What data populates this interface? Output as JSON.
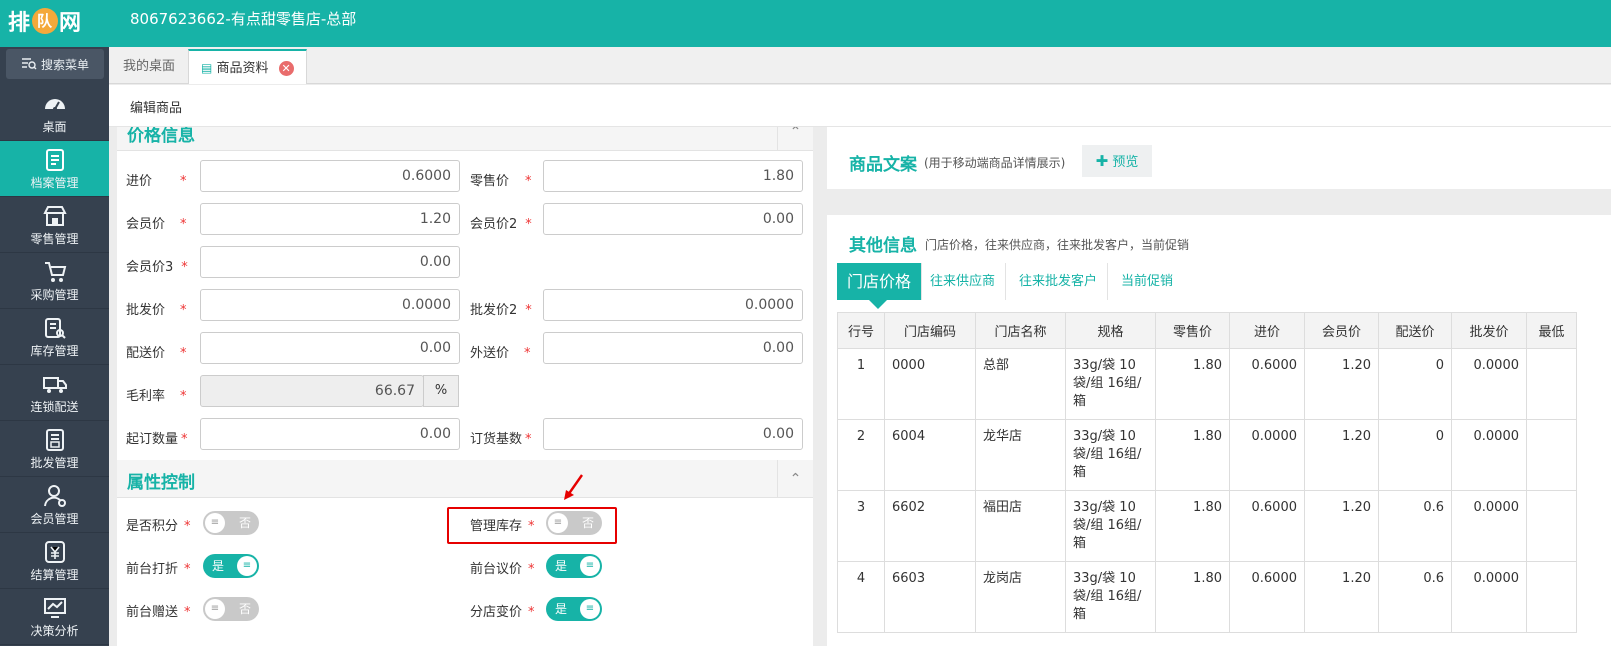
{
  "app": {
    "logo_left": "排",
    "logo_mid": "队",
    "logo_right": "网",
    "store_title": "8067623662-有点甜零售店-总部"
  },
  "sidebar": {
    "search_label": "搜索菜单",
    "items": [
      {
        "label": "桌面"
      },
      {
        "label": "档案管理"
      },
      {
        "label": "零售管理"
      },
      {
        "label": "采购管理"
      },
      {
        "label": "库存管理"
      },
      {
        "label": "连锁配送"
      },
      {
        "label": "批发管理"
      },
      {
        "label": "会员管理"
      },
      {
        "label": "结算管理"
      },
      {
        "label": "决策分析"
      }
    ]
  },
  "tabs": [
    {
      "label": "我的桌面"
    },
    {
      "label": "商品资料"
    }
  ],
  "page": {
    "subtitle": "编辑商品"
  },
  "price_section": {
    "title": "价格信息",
    "fields": {
      "jinjia": {
        "label": "进价",
        "value": "0.6000"
      },
      "lingshou": {
        "label": "零售价",
        "value": "1.80"
      },
      "huiyuan": {
        "label": "会员价",
        "value": "1.20"
      },
      "huiyuan2": {
        "label": "会员价2",
        "value": "0.00"
      },
      "huiyuan3": {
        "label": "会员价3",
        "value": "0.00"
      },
      "pifa": {
        "label": "批发价",
        "value": "0.0000"
      },
      "pifa2": {
        "label": "批发价2",
        "value": "0.0000"
      },
      "peisong": {
        "label": "配送价",
        "value": "0.00"
      },
      "waisong": {
        "label": "外送价",
        "value": "0.00"
      },
      "maoli": {
        "label": "毛利率",
        "value": "66.67",
        "unit": "%"
      },
      "qiding": {
        "label": "起订数量",
        "value": "0.00"
      },
      "dinghuo": {
        "label": "订货基数",
        "value": "0.00"
      }
    },
    "required_mark": "*"
  },
  "attr_section": {
    "title": "属性控制",
    "toggles": {
      "jifen": {
        "label": "是否积分",
        "state": "否"
      },
      "kucun": {
        "label": "管理库存",
        "state": "否"
      },
      "dazhe": {
        "label": "前台打折",
        "state": "是"
      },
      "yijia": {
        "label": "前台议价",
        "state": "是"
      },
      "zengsong": {
        "label": "前台赠送",
        "state": "否"
      },
      "bianjia": {
        "label": "分店变价",
        "state": "是"
      }
    }
  },
  "copy_panel": {
    "title": "商品文案",
    "subtitle": "(用于移动端商品详情展示)",
    "preview_label": "预览"
  },
  "other_panel": {
    "title": "其他信息",
    "subtitle": "门店价格，往来供应商，往来批发客户，当前促销",
    "tabs": [
      "门店价格",
      "往来供应商",
      "往来批发客户",
      "当前促销"
    ],
    "columns": [
      "行号",
      "门店编码",
      "门店名称",
      "规格",
      "零售价",
      "进价",
      "会员价",
      "配送价",
      "批发价",
      "最低"
    ],
    "rows": [
      [
        "1",
        "0000",
        "总部",
        "33g/袋 10袋/组 16组/箱",
        "1.80",
        "0.6000",
        "1.20",
        "0",
        "0.0000",
        ""
      ],
      [
        "2",
        "6004",
        "龙华店",
        "33g/袋 10袋/组 16组/箱",
        "1.80",
        "0.0000",
        "1.20",
        "0",
        "0.0000",
        ""
      ],
      [
        "3",
        "6602",
        "福田店",
        "33g/袋 10袋/组 16组/箱",
        "1.80",
        "0.6000",
        "1.20",
        "0.6",
        "0.0000",
        ""
      ],
      [
        "4",
        "6603",
        "龙岗店",
        "33g/袋 10袋/组 16组/箱",
        "1.80",
        "0.6000",
        "1.20",
        "0.6",
        "0.0000",
        ""
      ]
    ]
  },
  "colors": {
    "brand": "#17b3a7",
    "sidebar": "#36414f",
    "highlight": "#e60000"
  }
}
